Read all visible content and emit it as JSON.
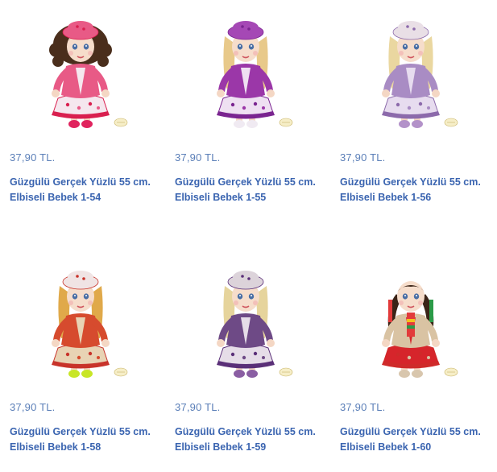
{
  "products": [
    {
      "price": "37,90 TL.",
      "title_line1": "Güzgülü Gerçek Yüzlü 55 cm.",
      "title_line2": "Elbiseli Bebek 1-54",
      "image": "doll-pink-dress",
      "colors": {
        "hair": "#4a2e1c",
        "main": "#e85a86",
        "accent": "#d91f4f",
        "skirt": "#f5e7ee",
        "hat": "#e85a86",
        "shoes": "#e0245e"
      }
    },
    {
      "price": "37,90 TL.",
      "title_line1": "Güzgülü Gerçek Yüzlü 55 cm.",
      "title_line2": "Elbiseli Bebek 1-55",
      "image": "doll-purple-dress",
      "colors": {
        "hair": "#e8c98a",
        "main": "#9b37a8",
        "accent": "#7a2490",
        "skirt": "#efe0f2",
        "hat": "#a548b5",
        "shoes": "#f0eaf2"
      }
    },
    {
      "price": "37,90 TL.",
      "title_line1": "Güzgülü Gerçek Yüzlü 55 cm.",
      "title_line2": "Elbiseli Bebek 1-56",
      "image": "doll-lilac-dress",
      "colors": {
        "hair": "#ead7a0",
        "main": "#a98cc4",
        "accent": "#8c6aab",
        "skirt": "#e7dcef",
        "hat": "#e9dfe6",
        "shoes": "#b392c9"
      }
    },
    {
      "price": "37,90 TL.",
      "title_line1": "Güzgülü Gerçek Yüzlü 55 cm.",
      "title_line2": "Elbiseli Bebek 1-58",
      "image": "doll-red-floral",
      "colors": {
        "hair": "#e0a94a",
        "main": "#d64b2e",
        "accent": "#c8332a",
        "skirt": "#e8d3b4",
        "hat": "#f0e4e4",
        "shoes": "#c8e627"
      }
    },
    {
      "price": "37,90 TL.",
      "title_line1": "Güzgülü Gerçek Yüzlü 55 cm.",
      "title_line2": "Elbiseli Bebek 1-59",
      "image": "doll-violet-coat",
      "colors": {
        "hair": "#e6d49c",
        "main": "#6e4a86",
        "accent": "#5a2f78",
        "skirt": "#e6dde8",
        "hat": "#dcd3da",
        "shoes": "#8a5ea3"
      }
    },
    {
      "price": "37,90 TL.",
      "title_line1": "Güzgülü Gerçek Yüzlü 55 cm.",
      "title_line2": "Elbiseli Bebek 1-60",
      "image": "doll-red-skirt",
      "colors": {
        "hair": "#3b2417",
        "main": "#d9c3a3",
        "accent": "#cf2a2a",
        "skirt": "#d6252b",
        "hat": "none",
        "shoes": "#d8c6ad"
      }
    }
  ]
}
